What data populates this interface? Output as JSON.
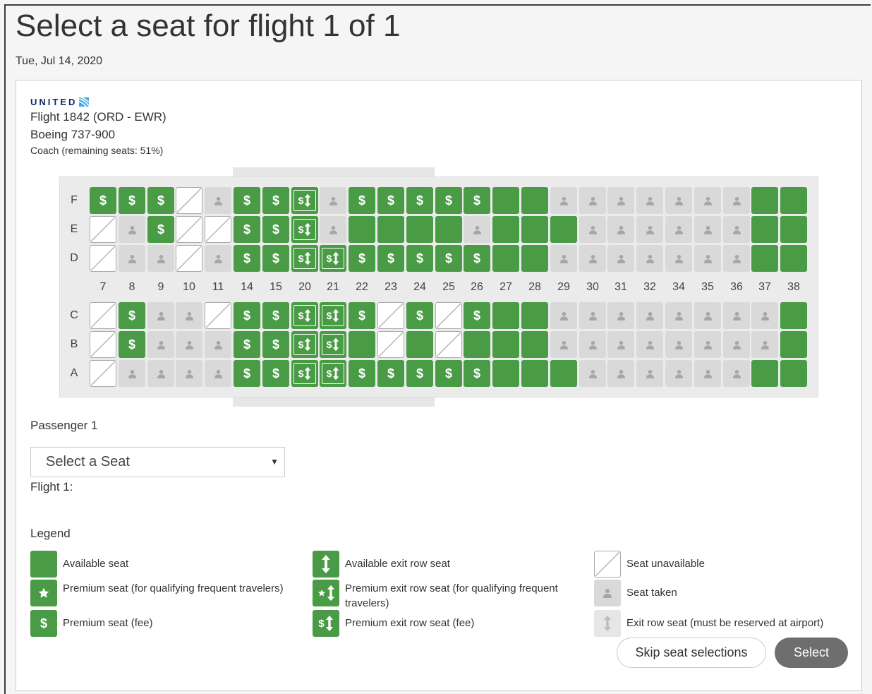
{
  "page": {
    "title": "Select a seat for flight 1 of 1",
    "date": "Tue, Jul 14, 2020"
  },
  "flight": {
    "airline_logo_text": "UNITED",
    "line1": "Flight 1842 (ORD - EWR)",
    "line2": "Boeing 737-900",
    "cabin": "Coach (remaining seats: 51%)"
  },
  "seatmap": {
    "columns": [
      "7",
      "8",
      "9",
      "10",
      "11",
      "14",
      "15",
      "20",
      "21",
      "22",
      "23",
      "24",
      "25",
      "26",
      "27",
      "28",
      "29",
      "30",
      "31",
      "32",
      "34",
      "35",
      "36",
      "37",
      "38"
    ],
    "upper_rows": [
      {
        "label": "F",
        "seats": [
          "fee",
          "fee",
          "fee",
          "unavail",
          "taken",
          "fee",
          "fee",
          "exitfee",
          "taken",
          "fee",
          "fee",
          "fee",
          "fee",
          "fee",
          "avail",
          "avail",
          "taken",
          "taken",
          "taken",
          "taken",
          "taken",
          "taken",
          "taken",
          "avail",
          "avail"
        ]
      },
      {
        "label": "E",
        "seats": [
          "unavail",
          "taken",
          "fee",
          "unavail",
          "unavail",
          "fee",
          "fee",
          "exitfee",
          "taken",
          "avail",
          "avail",
          "avail",
          "avail",
          "taken",
          "avail",
          "avail",
          "avail",
          "taken",
          "taken",
          "taken",
          "taken",
          "taken",
          "taken",
          "avail",
          "avail"
        ]
      },
      {
        "label": "D",
        "seats": [
          "unavail",
          "taken",
          "taken",
          "unavail",
          "taken",
          "fee",
          "fee",
          "exitfee",
          "exitfee",
          "fee",
          "fee",
          "fee",
          "fee",
          "fee",
          "avail",
          "avail",
          "taken",
          "taken",
          "taken",
          "taken",
          "taken",
          "taken",
          "taken",
          "avail",
          "avail"
        ]
      }
    ],
    "lower_rows": [
      {
        "label": "C",
        "seats": [
          "unavail",
          "fee",
          "taken",
          "taken",
          "unavail",
          "fee",
          "fee",
          "exitfee",
          "exitfee",
          "fee",
          "unavail",
          "fee",
          "unavail",
          "fee",
          "avail",
          "avail",
          "taken",
          "taken",
          "taken",
          "taken",
          "taken",
          "taken",
          "taken",
          "taken",
          "avail"
        ]
      },
      {
        "label": "B",
        "seats": [
          "unavail",
          "fee",
          "taken",
          "taken",
          "taken",
          "fee",
          "fee",
          "exitfee",
          "exitfee",
          "avail",
          "unavail",
          "avail",
          "unavail",
          "avail",
          "avail",
          "avail",
          "taken",
          "taken",
          "taken",
          "taken",
          "taken",
          "taken",
          "taken",
          "taken",
          "avail"
        ]
      },
      {
        "label": "A",
        "seats": [
          "unavail",
          "taken",
          "taken",
          "taken",
          "taken",
          "fee",
          "fee",
          "exitfee",
          "exitfee",
          "fee",
          "fee",
          "fee",
          "fee",
          "fee",
          "avail",
          "avail",
          "avail",
          "taken",
          "taken",
          "taken",
          "taken",
          "taken",
          "taken",
          "avail",
          "avail"
        ]
      }
    ]
  },
  "passenger": {
    "label": "Passenger 1",
    "select_value": "Select a Seat",
    "flight_label": "Flight 1:"
  },
  "legend": {
    "title": "Legend",
    "items": [
      {
        "icon": "available-seat",
        "text": "Available seat"
      },
      {
        "icon": "premium-star",
        "text": "Premium seat (for qualifying frequent travelers)"
      },
      {
        "icon": "premium-fee",
        "text": "Premium seat (fee)"
      },
      {
        "icon": "exit-row",
        "text": "Available exit row seat"
      },
      {
        "icon": "premium-exit-star",
        "text": "Premium exit row seat (for qualifying frequent travelers)"
      },
      {
        "icon": "premium-exit-fee",
        "text": "Premium exit row seat (fee)"
      },
      {
        "icon": "unavailable",
        "text": "Seat unavailable"
      },
      {
        "icon": "taken",
        "text": "Seat taken"
      },
      {
        "icon": "exit-airport",
        "text": "Exit row seat (must be reserved at airport)"
      }
    ]
  },
  "buttons": {
    "skip": "Skip seat selections",
    "select": "Select"
  },
  "colors": {
    "available": "#4a9b45",
    "taken": "#d9d9d9",
    "select_button": "#6e6e6e"
  }
}
